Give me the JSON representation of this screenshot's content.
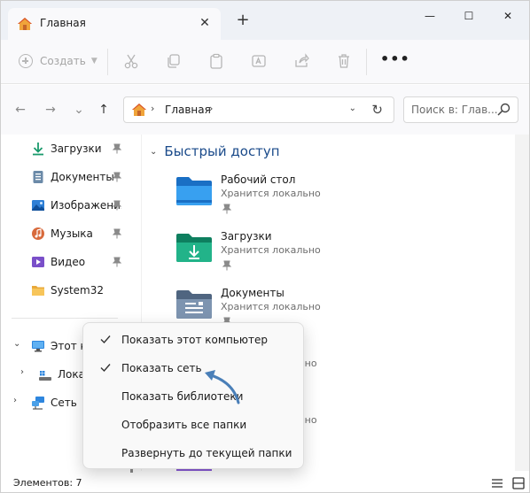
{
  "window": {
    "tab_title": "Главная",
    "close_tab_glyph": "✕",
    "new_tab_glyph": "+",
    "minimize_glyph": "—",
    "maximize_glyph": "☐",
    "close_glyph": "✕"
  },
  "toolbar": {
    "create_label": "Создать",
    "more_glyph": "•••",
    "icons": [
      "cut-icon",
      "copy-icon",
      "paste-icon",
      "rename-icon",
      "share-icon",
      "delete-icon"
    ]
  },
  "address": {
    "back_glyph": "←",
    "forward_glyph": "→",
    "recent_glyph": "⌄",
    "up_glyph": "↑",
    "sep_glyph": "›",
    "crumb": "Главная",
    "dropdown_glyph": "⌄",
    "refresh_glyph": "↻",
    "search_placeholder": "Поиск в: Глав..."
  },
  "sidebar": {
    "quick": [
      {
        "label": "Загрузки",
        "icon": "download-icon"
      },
      {
        "label": "Документы",
        "icon": "document-icon"
      },
      {
        "label": "Изображения",
        "icon": "image-icon"
      },
      {
        "label": "Музыка",
        "icon": "music-icon"
      },
      {
        "label": "Видео",
        "icon": "video-icon"
      },
      {
        "label": "System32",
        "icon": "folder-icon"
      }
    ],
    "tree": [
      {
        "label": "Этот компьютер",
        "twisty": "⌄"
      },
      {
        "label": "Локальный диск",
        "twisty": "›"
      },
      {
        "label": "Сеть",
        "twisty": "›"
      }
    ]
  },
  "content": {
    "group_title": "Быстрый доступ",
    "group_chevron": "⌄",
    "folders": [
      {
        "name": "Рабочий стол",
        "sub": "Хранится локально",
        "color": "#2f8ddb"
      },
      {
        "name": "Загрузки",
        "sub": "Хранится локально",
        "color": "#1aa17b"
      },
      {
        "name": "Документы",
        "sub": "Хранится локально",
        "color": "#5d7594"
      }
    ],
    "partial_subs": [
      "локально",
      "локально"
    ]
  },
  "status": {
    "items_label": "Элементов: 7"
  },
  "context_menu": {
    "items": [
      {
        "label": "Показать этот компьютер",
        "checked": true
      },
      {
        "label": "Показать сеть",
        "checked": true
      },
      {
        "label": "Показать библиотеки",
        "checked": false
      },
      {
        "label": "Отобразить все папки",
        "checked": false
      },
      {
        "label": "Развернуть до текущей папки",
        "checked": false
      }
    ]
  },
  "colors": {
    "accent": "#005fb8",
    "annotation_arrow": "#4a7fb8"
  }
}
